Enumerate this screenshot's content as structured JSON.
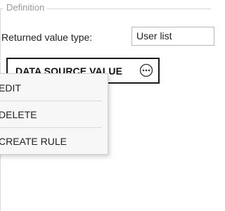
{
  "definition": {
    "legend": "Definition"
  },
  "returned_value_type": {
    "label": "Returned value type:",
    "selected": "User list"
  },
  "data_source": {
    "label": "DATA SOURCE VALUE",
    "more_icon": "more-horizontal-circle-icon"
  },
  "context_menu": {
    "items": [
      {
        "label": "EDIT"
      },
      {
        "label": "DELETE"
      },
      {
        "label": "CREATE RULE"
      }
    ]
  },
  "colors": {
    "border_dark": "#1a1a1a",
    "fieldset_line": "#d9d9d9",
    "legend_text": "#9a9a9a",
    "menu_bg": "#f7f7f7"
  }
}
